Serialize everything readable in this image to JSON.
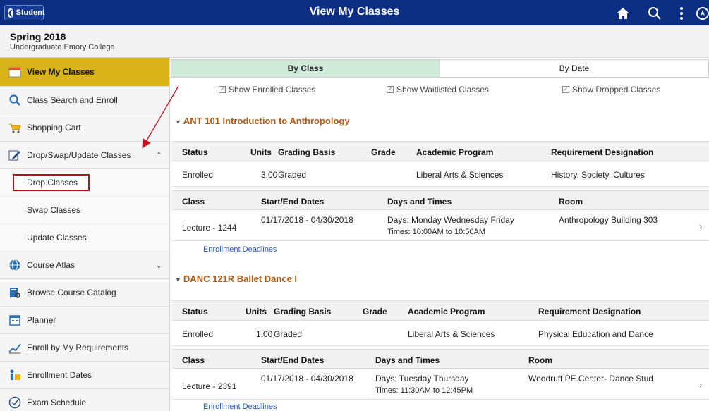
{
  "banner": {
    "back_label": "Student",
    "title": "View My Classes",
    "color": "#0c2e82"
  },
  "term": {
    "name": "Spring 2018",
    "career": "Undergraduate Emory College"
  },
  "sidebar": {
    "items": [
      {
        "label": "View My Classes",
        "icon": "calendar-icon",
        "active": true
      },
      {
        "label": "Class Search and Enroll",
        "icon": "search-icon"
      },
      {
        "label": "Shopping Cart",
        "icon": "cart-icon"
      },
      {
        "label": "Drop/Swap/Update Classes",
        "icon": "edit-icon",
        "expanded": true
      }
    ],
    "sub_items": [
      {
        "label": "Drop Classes",
        "highlighted": true
      },
      {
        "label": "Swap Classes"
      },
      {
        "label": "Update Classes"
      }
    ],
    "items_after": [
      {
        "label": "Course Atlas",
        "icon": "globe-icon",
        "collapsible": true
      },
      {
        "label": "Browse Course Catalog",
        "icon": "catalog-icon"
      },
      {
        "label": "Planner",
        "icon": "planner-icon"
      },
      {
        "label": "Enroll by My Requirements",
        "icon": "chart-icon"
      },
      {
        "label": "Enrollment Dates",
        "icon": "dates-icon"
      },
      {
        "label": "Exam Schedule",
        "icon": "clock-icon"
      }
    ],
    "active_color": "#d8b419"
  },
  "tabs": [
    {
      "label": "By Class",
      "active": true
    },
    {
      "label": "By Date",
      "active": false
    }
  ],
  "filters": [
    {
      "label": "Show Enrolled Classes",
      "checked": true
    },
    {
      "label": "Show Waitlisted Classes",
      "checked": true
    },
    {
      "label": "Show Dropped Classes",
      "checked": true
    }
  ],
  "enroll_headers": {
    "status": "Status",
    "units": "Units",
    "grading": "Grading Basis",
    "grade": "Grade",
    "program": "Academic Program",
    "requirement": "Requirement Designation"
  },
  "section_headers": {
    "class": "Class",
    "dates": "Start/End Dates",
    "days": "Days and Times",
    "room": "Room"
  },
  "courses": [
    {
      "title": "ANT 101 Introduction to Anthropology",
      "status": "Enrolled",
      "units": "3.00",
      "grading": "Graded",
      "grade": "",
      "program": "Liberal Arts & Sciences",
      "requirement": "History, Society, Cultures",
      "class": "Lecture - 1244",
      "dates": "01/17/2018 - 04/30/2018",
      "days": "Days: Monday Wednesday Friday",
      "times": "Times: 10:00AM to 10:50AM",
      "room": "Anthropology Building 303",
      "deadline_link": "Enrollment Deadlines"
    },
    {
      "title": "DANC 121R Ballet Dance I",
      "status": "Enrolled",
      "units": "1.00",
      "grading": "Graded",
      "grade": "",
      "program": "Liberal Arts & Sciences",
      "requirement": "Physical Education and Dance",
      "class": "Lecture - 2391",
      "dates": "01/17/2018 - 04/30/2018",
      "days": "Days: Tuesday Thursday",
      "times": "Times: 11:30AM to 12:45PM",
      "room": "Woodruff PE Center- Dance Stud",
      "deadline_link": "Enrollment Deadlines"
    }
  ],
  "course_title_color": "#b35a12",
  "link_color": "#2c5aa8",
  "annotation_color": "#c0141c"
}
